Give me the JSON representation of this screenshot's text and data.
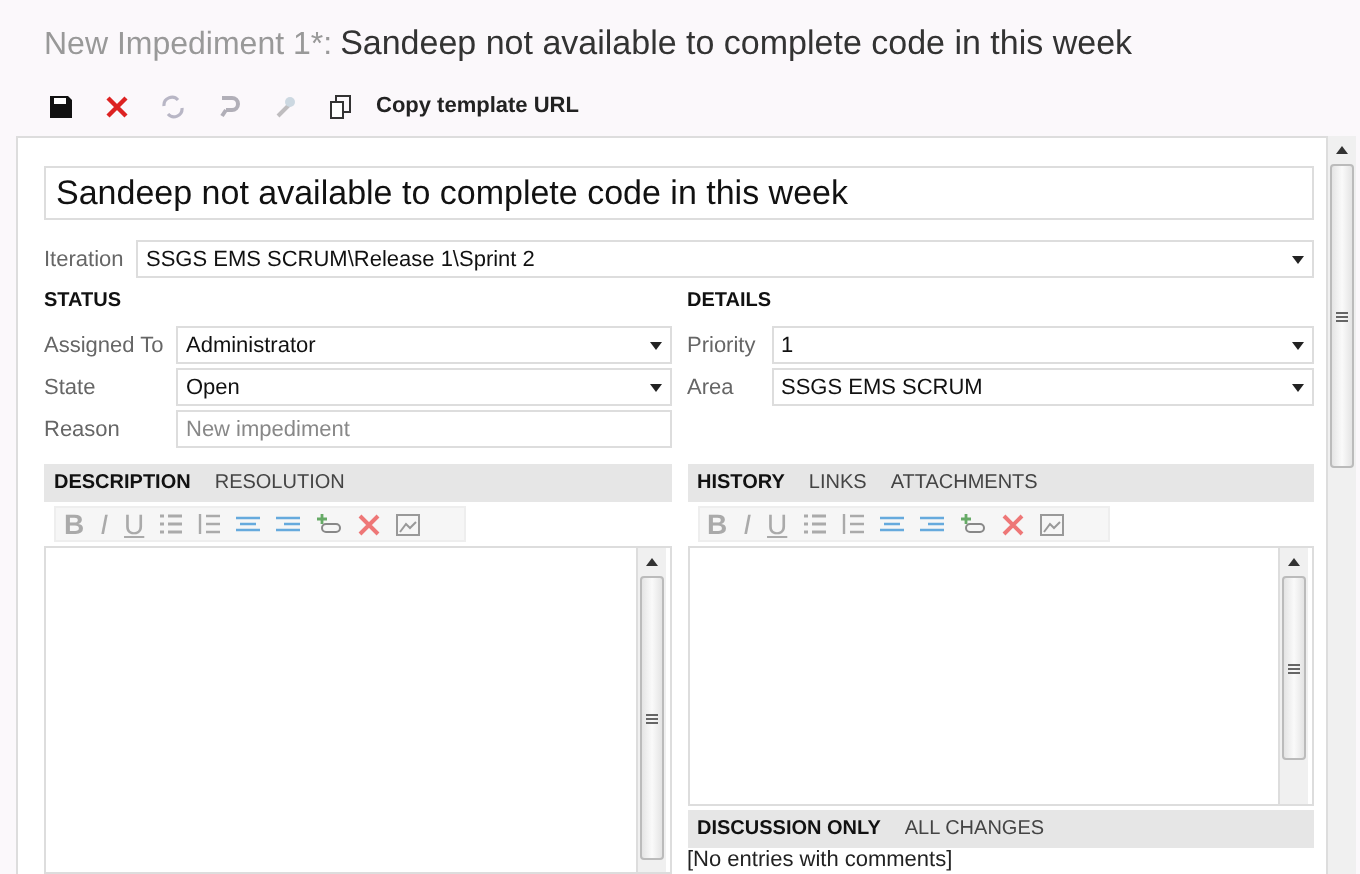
{
  "window": {
    "title_prefix": "New Impediment 1*:",
    "title": "Sandeep not available to complete code in this week"
  },
  "toolbar": {
    "icons": [
      {
        "kind": "save",
        "disabled": false
      },
      {
        "kind": "close",
        "disabled": false
      },
      {
        "kind": "refresh",
        "disabled": true
      },
      {
        "kind": "undo",
        "disabled": true
      },
      {
        "kind": "tool",
        "disabled": true
      },
      {
        "kind": "copy",
        "disabled": false
      }
    ],
    "link": "Copy template URL"
  },
  "title_field": {
    "value": "Sandeep not available to complete code in this week"
  },
  "iteration": {
    "label": "Iteration",
    "value": "SSGS EMS SCRUM\\Release 1\\Sprint 2"
  },
  "status": {
    "heading": "STATUS",
    "fields": [
      {
        "label": "Assigned To",
        "value": "Administrator",
        "kind": "dropdown",
        "disabled": false
      },
      {
        "label": "State",
        "value": "Open",
        "kind": "dropdown",
        "disabled": false
      },
      {
        "label": "Reason",
        "value": "New impediment",
        "kind": "text",
        "disabled": true
      }
    ]
  },
  "details": {
    "heading": "DETAILS",
    "fields": [
      {
        "label": "Priority",
        "value": "1",
        "kind": "dropdown",
        "disabled": false
      },
      {
        "label": "Area",
        "value": "SSGS EMS SCRUM",
        "kind": "dropdown",
        "disabled": false
      }
    ]
  },
  "left_panel": {
    "tabs": [
      {
        "label": "DESCRIPTION",
        "selected": true
      },
      {
        "label": "RESOLUTION",
        "selected": false
      }
    ],
    "format_buttons": [
      "B",
      "I",
      "U"
    ]
  },
  "right_panel": {
    "tabs": [
      {
        "label": "HISTORY",
        "selected": true
      },
      {
        "label": "LINKS",
        "selected": false
      },
      {
        "label": "ATTACHMENTS",
        "selected": false
      }
    ],
    "format_buttons": [
      "B",
      "I",
      "U"
    ],
    "history_tabs": [
      {
        "label": "DISCUSSION ONLY",
        "selected": true
      },
      {
        "label": "ALL CHANGES",
        "selected": false
      }
    ],
    "history_text": "[No entries with comments]"
  }
}
